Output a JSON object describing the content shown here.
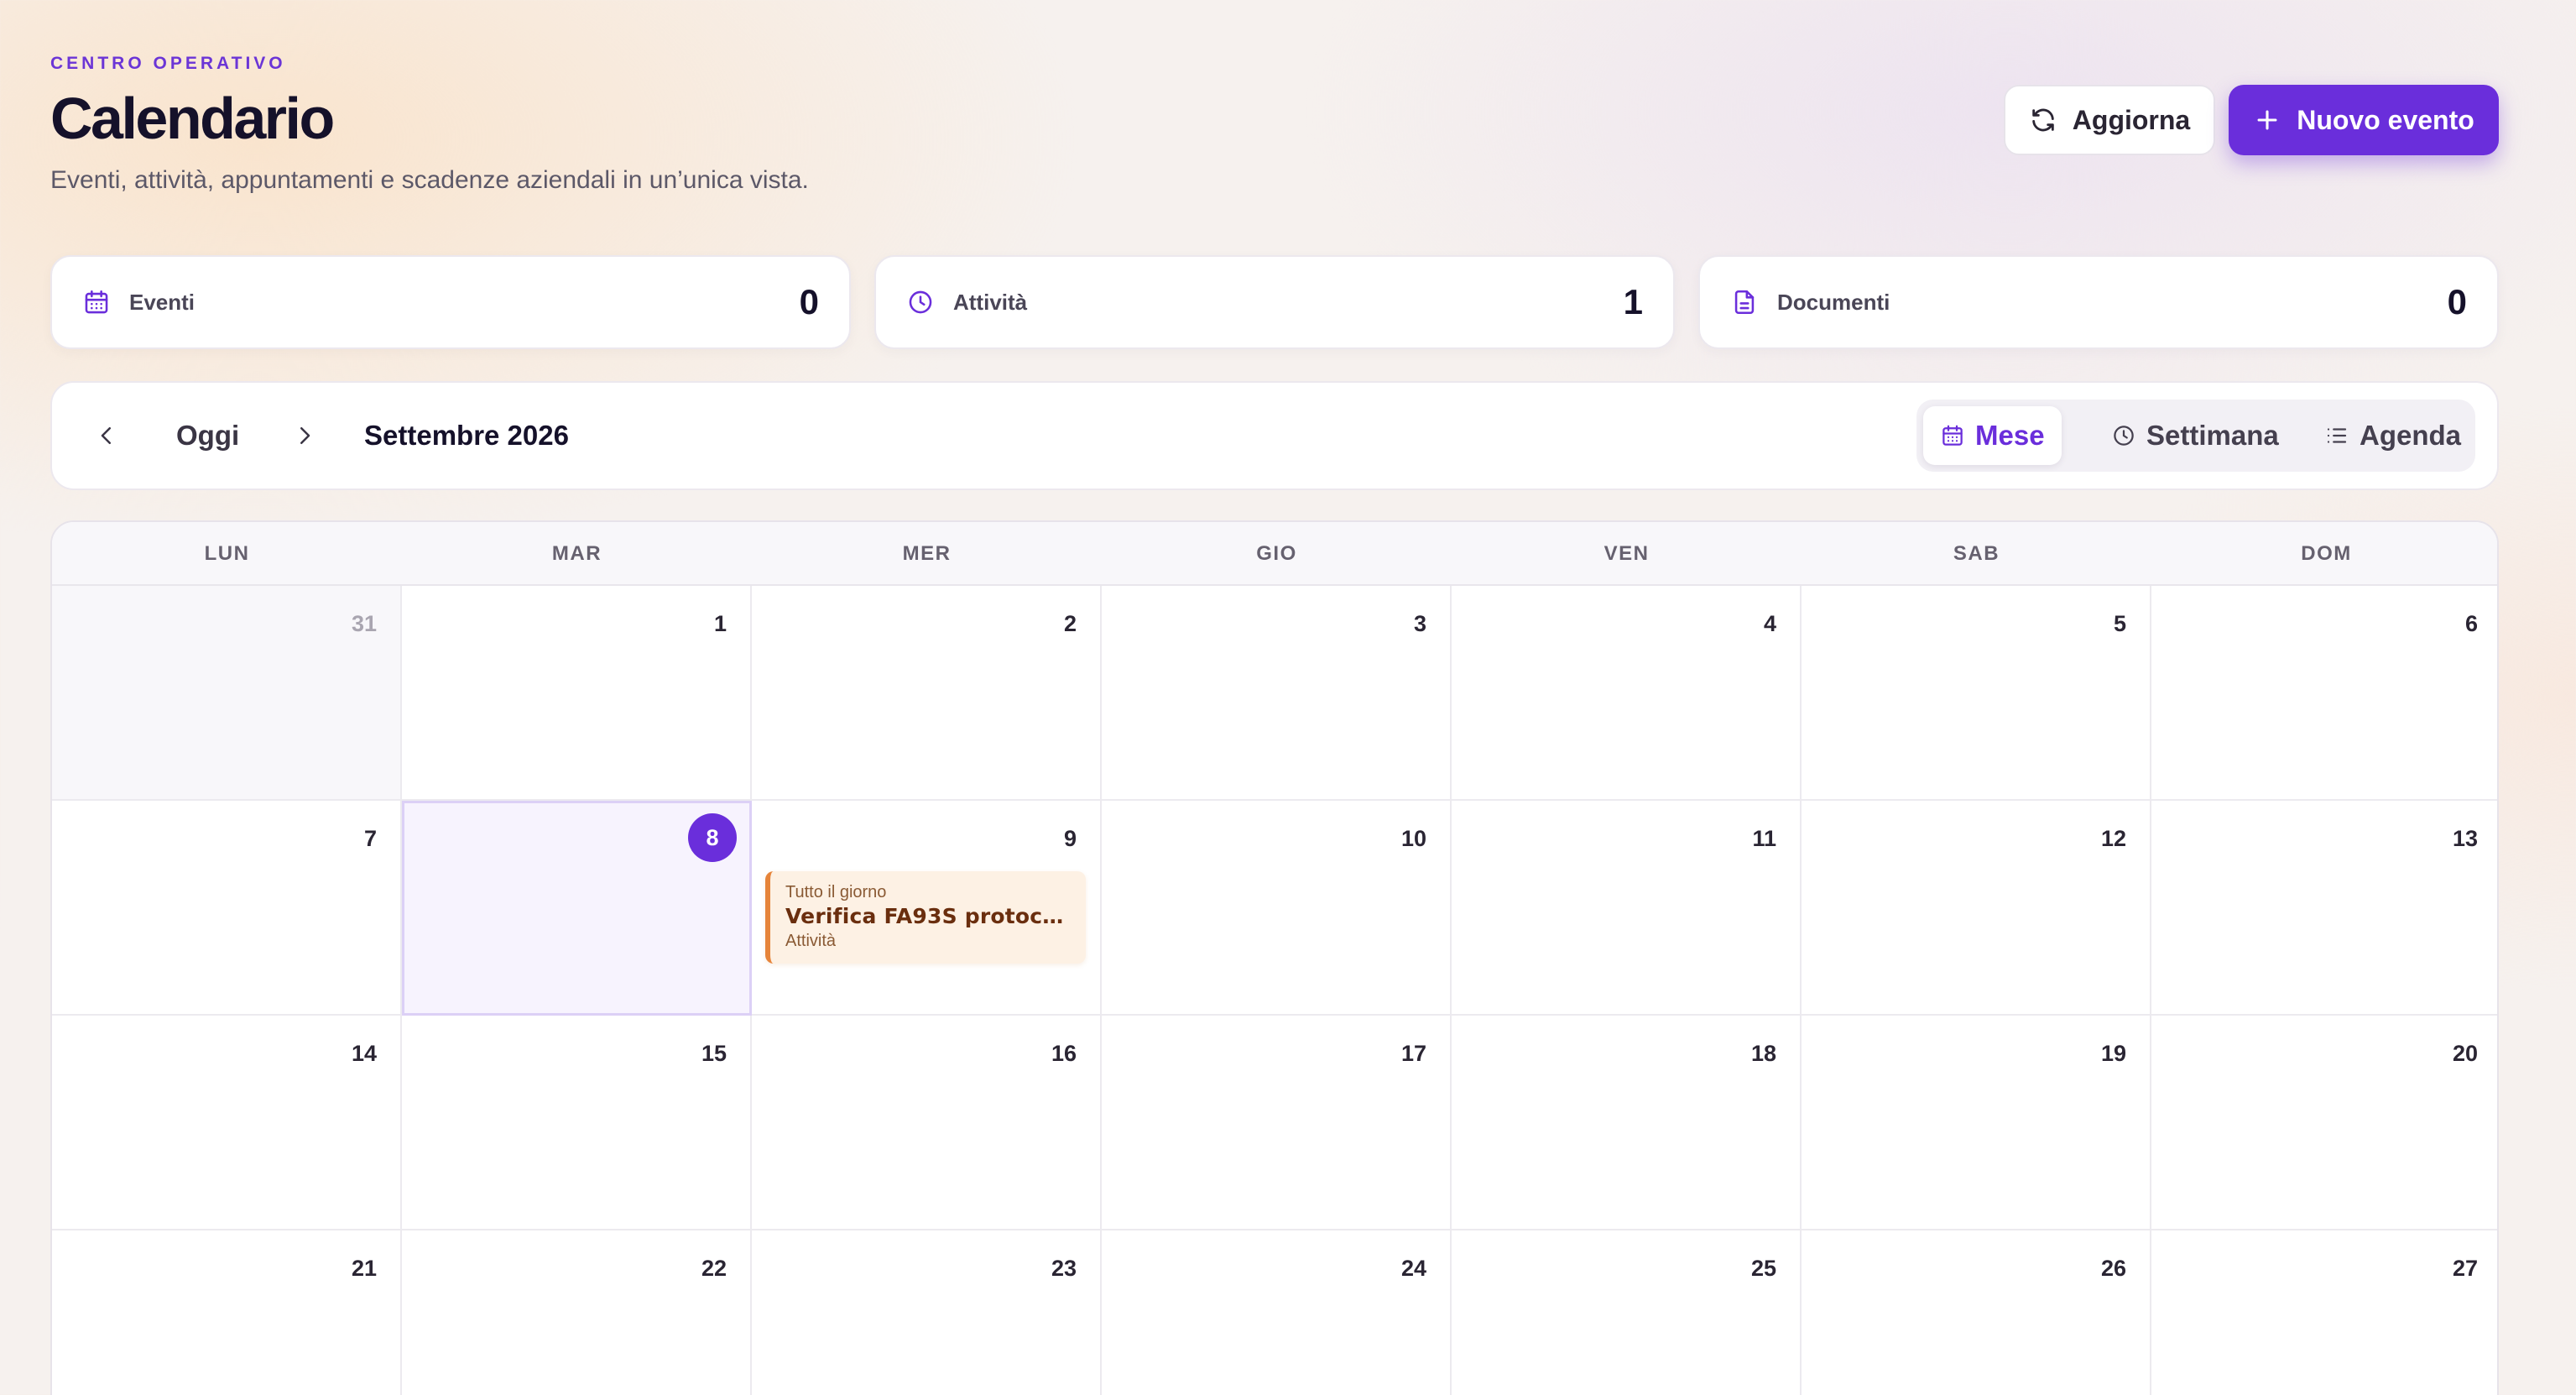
{
  "header": {
    "eyebrow": "CENTRO OPERATIVO",
    "title": "Calendario",
    "subtitle": "Eventi, attività, appuntamenti e scadenze aziendali in un’unica vista."
  },
  "actions": {
    "refresh_label": "Aggiorna",
    "new_event_label": "Nuovo evento"
  },
  "stats": [
    {
      "label": "Eventi",
      "value": "0",
      "icon": "calendar-icon"
    },
    {
      "label": "Attività",
      "value": "1",
      "icon": "clock-icon"
    },
    {
      "label": "Documenti",
      "value": "0",
      "icon": "document-icon"
    }
  ],
  "toolbar": {
    "today_label": "Oggi",
    "current_month": "Settembre 2026",
    "views": [
      {
        "label": "Mese",
        "icon": "calendar-icon",
        "active": true
      },
      {
        "label": "Settimana",
        "icon": "clock-icon",
        "active": false
      },
      {
        "label": "Agenda",
        "icon": "list-icon",
        "active": false
      }
    ]
  },
  "calendar": {
    "weekdays": [
      "LUN",
      "MAR",
      "MER",
      "GIO",
      "VEN",
      "SAB",
      "DOM"
    ],
    "weeks": [
      [
        "31",
        "1",
        "2",
        "3",
        "4",
        "5",
        "6"
      ],
      [
        "7",
        "8",
        "9",
        "10",
        "11",
        "12",
        "13"
      ],
      [
        "14",
        "15",
        "16",
        "17",
        "18",
        "19",
        "20"
      ],
      [
        "21",
        "22",
        "23",
        "24",
        "25",
        "26",
        "27"
      ]
    ],
    "today": "8",
    "event": {
      "day": "9",
      "time": "Tutto il giorno",
      "title": "Verifica FA93S protocol v...",
      "type": "Attività"
    }
  },
  "colors": {
    "accent": "#6a2edb",
    "event_bg": "#fdf1e4",
    "event_border": "#e6843a"
  }
}
